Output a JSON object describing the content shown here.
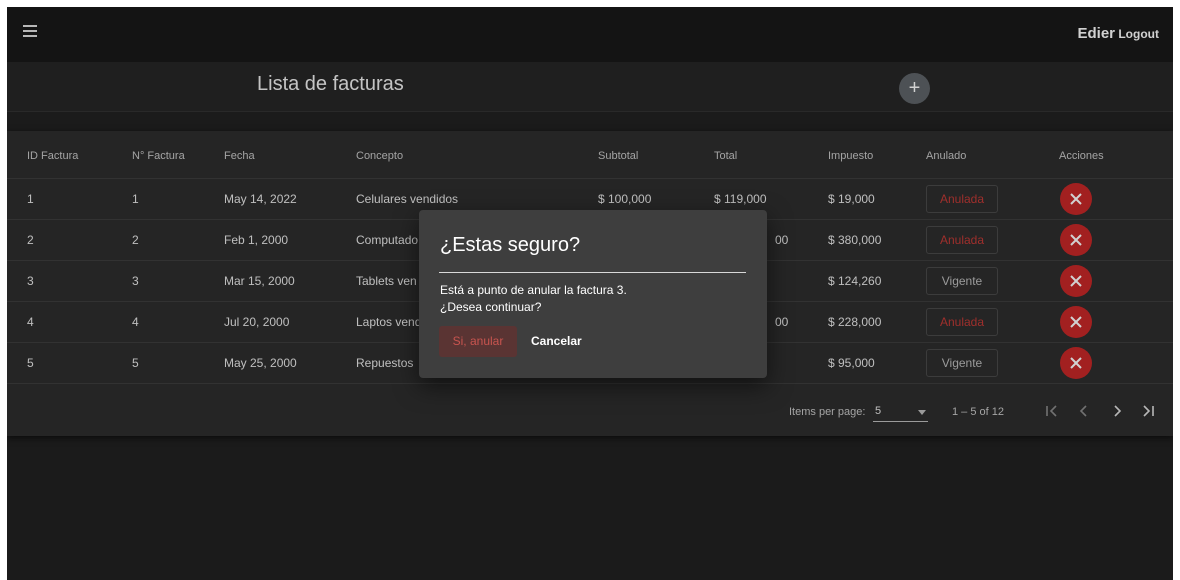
{
  "toolbar": {
    "user_name": "Edier",
    "logout_label": "Logout"
  },
  "header": {
    "title": "Lista de facturas",
    "add_label": "+"
  },
  "table": {
    "columns": [
      "ID Factura",
      "N° Factura",
      "Fecha",
      "Concepto",
      "Subtotal",
      "Total",
      "Impuesto",
      "Anulado",
      "Acciones"
    ],
    "rows": [
      {
        "id": "1",
        "number": "1",
        "date": "May 14, 2022",
        "concept": "Celulares vendidos",
        "subtotal": "$ 100,000",
        "total": "$ 119,000",
        "tax": "$ 19,000",
        "status": "Anulada"
      },
      {
        "id": "2",
        "number": "2",
        "date": "Feb 1, 2000",
        "concept": "Computado",
        "subtotal": "",
        "total": "00",
        "tax": "$ 380,000",
        "status": "Anulada"
      },
      {
        "id": "3",
        "number": "3",
        "date": "Mar 15, 2000",
        "concept": "Tablets ven",
        "subtotal": "",
        "total": "",
        "tax": "$ 124,260",
        "status": "Vigente"
      },
      {
        "id": "4",
        "number": "4",
        "date": "Jul 20, 2000",
        "concept": "Laptos vend",
        "subtotal": "",
        "total": "00",
        "tax": "$ 228,000",
        "status": "Anulada"
      },
      {
        "id": "5",
        "number": "5",
        "date": "May 25, 2000",
        "concept": "Repuestos ",
        "subtotal": "",
        "total": "",
        "tax": "$ 95,000",
        "status": "Vigente"
      }
    ]
  },
  "paginator": {
    "items_per_page_label": "Items per page:",
    "page_size": "5",
    "range_label": "1 – 5 of 12"
  },
  "dialog": {
    "title": "¿Estas seguro?",
    "message_line1": "Está a punto de anular la factura 3.",
    "message_line2": "¿Desea continuar?",
    "confirm_label": "Si, anular",
    "cancel_label": "Cancelar"
  },
  "colors": {
    "annulled": "#c23a36",
    "delete_button": "#c62828",
    "background": "#212121"
  },
  "icons": {
    "menu": "hamburger-icon",
    "delete": "close-icon",
    "first": "first-page-icon",
    "prev": "chevron-left-icon",
    "next": "chevron-right-icon",
    "last": "last-page-icon"
  }
}
